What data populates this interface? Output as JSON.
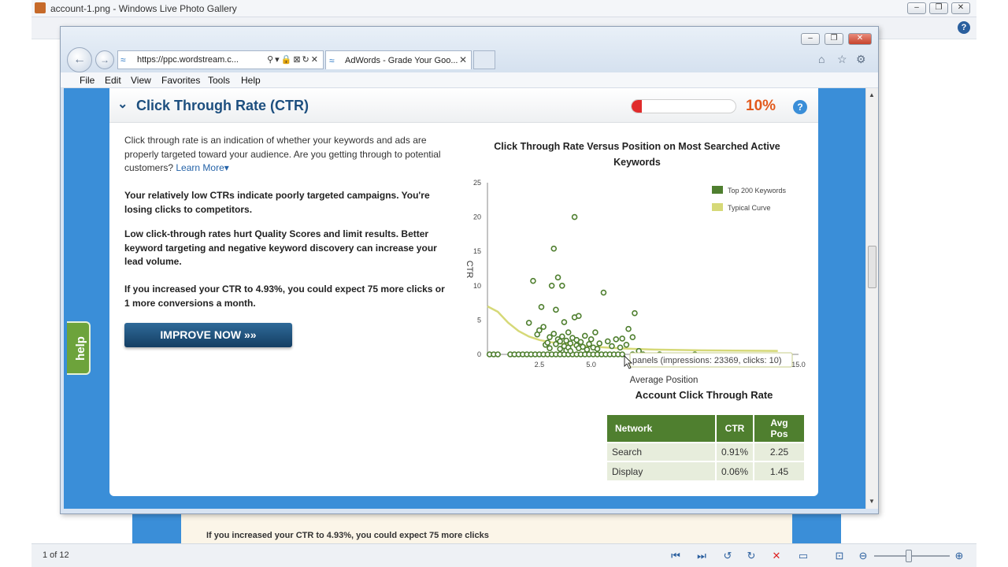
{
  "gallery": {
    "title": "account-1.png - Windows Live Photo Gallery",
    "page_counter": "1 of 12",
    "background_excerpt": "If you increased your CTR to 4.93%, you could expect 75 more clicks"
  },
  "browser": {
    "url": "https://ppc.wordstream.c...",
    "tab_title": "AdWords - Grade Your Goo...",
    "menu": [
      "File",
      "Edit",
      "View",
      "Favorites",
      "Tools",
      "Help"
    ]
  },
  "page": {
    "help_tab": "help",
    "section_title": "Click Through Rate (CTR)",
    "score_percent": "10%",
    "score_fraction": 0.1,
    "intro": "Click through rate is an indication of whether your keywords and ads are properly targeted toward your audience. Are you getting through to potential customers?",
    "learn_more": "Learn More",
    "para1": "Your relatively low CTRs indicate poorly targeted campaigns. You're losing clicks to competitors.",
    "para2": "Low click-through rates hurt Quality Scores and limit results. Better keyword targeting and negative keyword discovery can increase your lead volume.",
    "para3": "If you increased your CTR to 4.93%, you could expect 75 more clicks or 1 more conversions a month.",
    "improve_button": "IMPROVE NOW",
    "tooltip": "panels (impressions: 23369, clicks: 10)",
    "account_ctr_title": "Account Click Through Rate",
    "table": {
      "headers": [
        "Network",
        "CTR",
        "Avg Pos"
      ],
      "rows": [
        [
          "Search",
          "0.91%",
          "2.25"
        ],
        [
          "Display",
          "0.06%",
          "1.45"
        ]
      ]
    }
  },
  "chart_data": {
    "type": "scatter",
    "title": "Click Through Rate Versus Position on Most Searched Active Keywords",
    "xlabel": "Average Position",
    "ylabel": "CTR",
    "xlim": [
      0,
      15
    ],
    "ylim": [
      0,
      25
    ],
    "yticks": [
      0,
      5,
      10,
      15,
      20,
      25
    ],
    "xtick_labels": [
      "2.5",
      "5.0",
      "15.0"
    ],
    "xticks": [
      2.5,
      5.0,
      15.0
    ],
    "colors": {
      "points": "#4f7f2f",
      "curve": "#d6d978"
    },
    "series": [
      {
        "name": "Top 200 Keywords",
        "points": [
          [
            0.1,
            0
          ],
          [
            0.3,
            0
          ],
          [
            0.5,
            0
          ],
          [
            1.1,
            0
          ],
          [
            1.3,
            0
          ],
          [
            1.5,
            0
          ],
          [
            1.7,
            0
          ],
          [
            1.9,
            0
          ],
          [
            2.1,
            0
          ],
          [
            2.3,
            0
          ],
          [
            2.5,
            0
          ],
          [
            2.7,
            0
          ],
          [
            2.9,
            0
          ],
          [
            3.1,
            0
          ],
          [
            3.3,
            0
          ],
          [
            3.5,
            0
          ],
          [
            3.7,
            0
          ],
          [
            3.9,
            0
          ],
          [
            4.1,
            0
          ],
          [
            4.3,
            0
          ],
          [
            4.5,
            0
          ],
          [
            4.7,
            0
          ],
          [
            4.9,
            0
          ],
          [
            5.1,
            0
          ],
          [
            5.3,
            0
          ],
          [
            5.5,
            0
          ],
          [
            5.7,
            0
          ],
          [
            5.9,
            0
          ],
          [
            6.1,
            0
          ],
          [
            6.3,
            0
          ],
          [
            6.5,
            0
          ],
          [
            7.0,
            0
          ],
          [
            7.5,
            0
          ],
          [
            8.3,
            0
          ],
          [
            10.0,
            0
          ],
          [
            2.0,
            4.6
          ],
          [
            2.2,
            10.7
          ],
          [
            2.4,
            2.9
          ],
          [
            2.5,
            3.5
          ],
          [
            2.6,
            6.9
          ],
          [
            2.7,
            4.0
          ],
          [
            2.8,
            1.4
          ],
          [
            2.9,
            1.7
          ],
          [
            3.0,
            0.9
          ],
          [
            3.0,
            2.5
          ],
          [
            3.1,
            10.0
          ],
          [
            3.2,
            15.4
          ],
          [
            3.2,
            3.0
          ],
          [
            3.3,
            1.5
          ],
          [
            3.3,
            6.5
          ],
          [
            3.4,
            11.2
          ],
          [
            3.4,
            2.2
          ],
          [
            3.5,
            0.8
          ],
          [
            3.5,
            1.9
          ],
          [
            3.6,
            2.6
          ],
          [
            3.6,
            10.0
          ],
          [
            3.7,
            4.7
          ],
          [
            3.7,
            1.2
          ],
          [
            3.8,
            0.6
          ],
          [
            3.8,
            2.0
          ],
          [
            3.9,
            1.0
          ],
          [
            3.9,
            3.2
          ],
          [
            4.0,
            1.6
          ],
          [
            4.0,
            0.5
          ],
          [
            4.1,
            2.4
          ],
          [
            4.2,
            20.0
          ],
          [
            4.2,
            5.4
          ],
          [
            4.3,
            1.3
          ],
          [
            4.3,
            2.1
          ],
          [
            4.4,
            5.6
          ],
          [
            4.4,
            0.9
          ],
          [
            4.5,
            1.8
          ],
          [
            4.6,
            1.1
          ],
          [
            4.7,
            2.7
          ],
          [
            4.8,
            0.7
          ],
          [
            4.9,
            1.5
          ],
          [
            5.0,
            2.2
          ],
          [
            5.1,
            1.0
          ],
          [
            5.2,
            3.2
          ],
          [
            5.3,
            0.8
          ],
          [
            5.4,
            1.6
          ],
          [
            5.6,
            9.0
          ],
          [
            5.8,
            1.9
          ],
          [
            6.0,
            1.2
          ],
          [
            6.2,
            2.2
          ],
          [
            6.4,
            1.0
          ],
          [
            6.5,
            2.3
          ],
          [
            6.7,
            1.4
          ],
          [
            6.8,
            3.7
          ],
          [
            7.0,
            2.5
          ],
          [
            7.1,
            6.0
          ],
          [
            7.3,
            0.5
          ]
        ]
      },
      {
        "name": "Typical Curve",
        "points": [
          [
            0,
            7
          ],
          [
            0.5,
            6.2
          ],
          [
            1,
            4.6
          ],
          [
            1.5,
            3.4
          ],
          [
            2,
            2.6
          ],
          [
            2.5,
            2.1
          ],
          [
            3,
            1.8
          ],
          [
            4,
            1.4
          ],
          [
            5,
            1.15
          ],
          [
            6,
            0.95
          ],
          [
            7,
            0.8
          ],
          [
            8,
            0.7
          ],
          [
            10,
            0.6
          ],
          [
            12,
            0.55
          ],
          [
            14,
            0.5
          ]
        ]
      }
    ],
    "legend_position": "top-right",
    "grid": false
  }
}
